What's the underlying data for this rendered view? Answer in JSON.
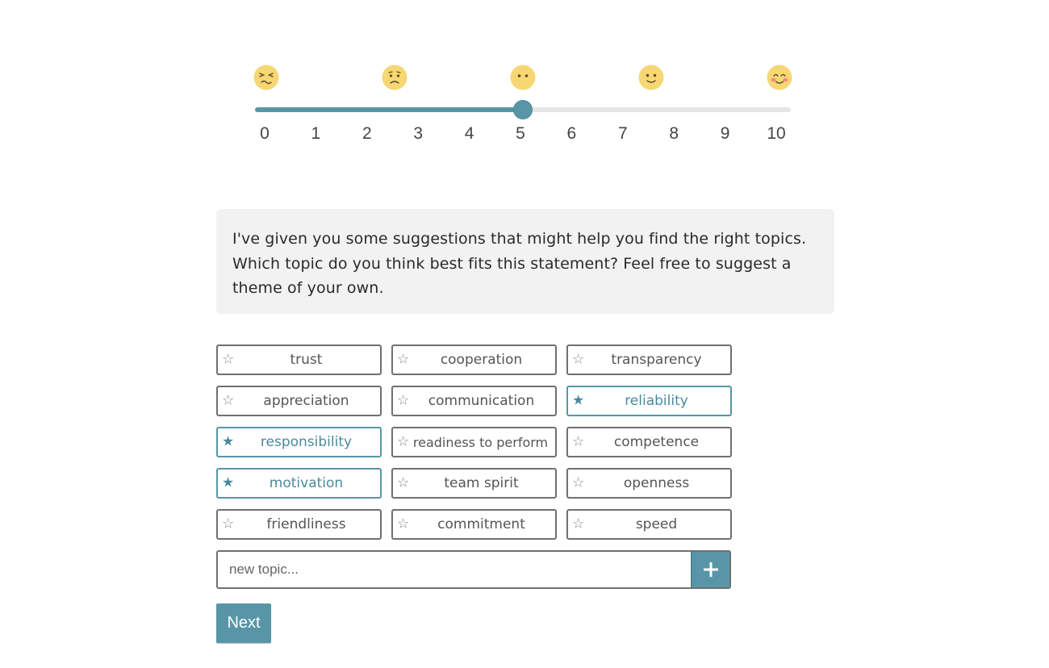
{
  "slider": {
    "value": 5,
    "min": 0,
    "max": 10,
    "ticks": [
      "0",
      "1",
      "2",
      "3",
      "4",
      "5",
      "6",
      "7",
      "8",
      "9",
      "10"
    ],
    "emojis": [
      "weary-face-icon",
      "frowning-face-icon",
      "neutral-face-icon",
      "slightly-smiling-face-icon",
      "smiling-blushing-face-icon"
    ],
    "accent_color": "#5896a7"
  },
  "prompt": {
    "text": "I've given you some suggestions that might help you find the right topics. Which topic do you think best fits this statement? Feel free to suggest a theme of your own."
  },
  "topics": [
    {
      "label": "trust",
      "selected": false
    },
    {
      "label": "cooperation",
      "selected": false
    },
    {
      "label": "transparency",
      "selected": false
    },
    {
      "label": "appreciation",
      "selected": false
    },
    {
      "label": "communication",
      "selected": false
    },
    {
      "label": "reliability",
      "selected": true
    },
    {
      "label": "responsibility",
      "selected": true
    },
    {
      "label": "readiness to perform",
      "selected": false
    },
    {
      "label": "competence",
      "selected": false
    },
    {
      "label": "motivation",
      "selected": true
    },
    {
      "label": "team spirit",
      "selected": false
    },
    {
      "label": "openness",
      "selected": false
    },
    {
      "label": "friendliness",
      "selected": false
    },
    {
      "label": "commitment",
      "selected": false
    },
    {
      "label": "speed",
      "selected": false
    }
  ],
  "star_empty": "☆",
  "star_filled": "★",
  "new_topic": {
    "placeholder": "new topic...",
    "value": "",
    "add_icon": "plus-icon"
  },
  "next_label": "Next"
}
